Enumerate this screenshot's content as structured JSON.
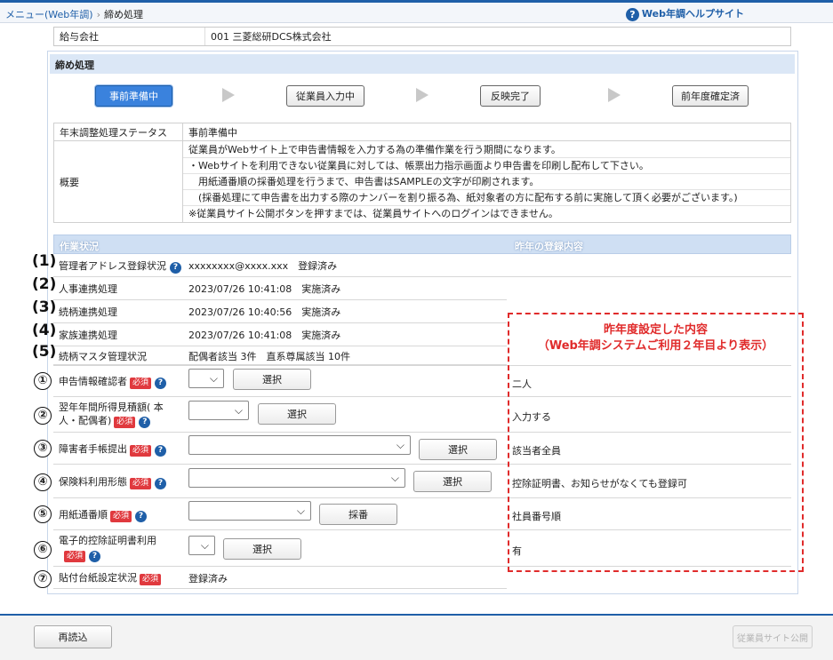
{
  "breadcrumb": {
    "menu": "メニュー(Web年調)",
    "separator": "›",
    "current": "締め処理"
  },
  "help": {
    "label": "Web年調ヘルプサイト"
  },
  "company": {
    "label": "給与会社",
    "value": "001 三菱総研DCS株式会社"
  },
  "section_title": "締め処理",
  "steps": [
    "事前準備中",
    "従業員入力中",
    "反映完了",
    "前年度確定済"
  ],
  "active_step": "事前準備中",
  "status": {
    "label": "年末調整処理ステータス",
    "value": "事前準備中"
  },
  "overview": {
    "label": "概要",
    "lines": [
      "従業員がWebサイト上で申告書情報を入力する為の準備作業を行う期間になります。",
      "・Webサイトを利用できない従業員に対しては、帳票出力指示画面より申告書を印刷し配布して下さい。",
      "　用紙通番順の採番処理を行うまで、申告書はSAMPLEの文字が印刷されます。",
      "　(採番処理にて申告書を出力する際のナンバーを割り振る為、紙対象者の方に配布する前に実施して頂く必要がございます。)",
      "※従業員サイト公開ボタンを押すまでは、従業員サイトへのログインはできません。"
    ]
  },
  "work_header": {
    "left": "作業状況",
    "right": "昨年の登録内容"
  },
  "status_rows": [
    {
      "num": "(1)",
      "label": "管理者アドレス登録状況",
      "value": "xxxxxxxx@xxxx.xxx　登録済み"
    },
    {
      "num": "(2)",
      "label": "人事連携処理",
      "value": "2023/07/26 10:41:08　実施済み"
    },
    {
      "num": "(3)",
      "label": "続柄連携処理",
      "value": "2023/07/26 10:40:56　実施済み"
    },
    {
      "num": "(4)",
      "label": "家族連携処理",
      "value": "2023/07/26 10:41:08　実施済み"
    },
    {
      "num": "(5)",
      "label": "続柄マスタ管理状況",
      "value": "配偶者該当 3件　直系尊属該当 10件"
    }
  ],
  "settings": {
    "required": "必須",
    "select_label": "選択",
    "number_label": "採番",
    "rows": [
      {
        "num": "①",
        "label": "申告情報確認者",
        "prev": "二人"
      },
      {
        "num": "②",
        "label_l1": "翌年年間所得見積額( 本",
        "label_l2": "人・配偶者)",
        "prev": "入力する"
      },
      {
        "num": "③",
        "label": "障害者手帳提出",
        "prev": "該当者全員"
      },
      {
        "num": "④",
        "label": "保険料利用形態",
        "prev": "控除証明書、お知らせがなくても登録可"
      },
      {
        "num": "⑤",
        "label": "用紙通番順",
        "prev": "社員番号順"
      },
      {
        "num": "⑥",
        "label": "電子的控除証明書利用",
        "prev": "有"
      },
      {
        "num": "⑦",
        "label": "貼付台紙設定状況",
        "value": "登録済み"
      }
    ]
  },
  "callout": {
    "line1": "昨年度設定した内容",
    "line2": "（Web年調システムご利用２年目より表示）"
  },
  "footer": {
    "reload": "再読込",
    "publish": "従業員サイト公開"
  }
}
